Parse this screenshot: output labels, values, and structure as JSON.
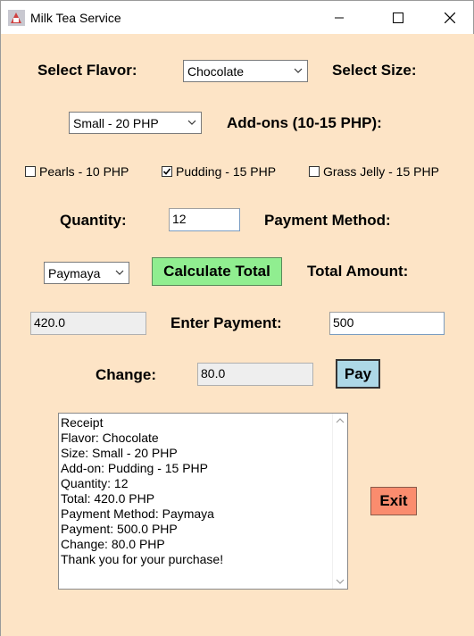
{
  "window": {
    "title": "Milk Tea Service",
    "controls": [
      "minimize",
      "maximize",
      "close"
    ]
  },
  "form": {
    "flavor_label": "Select Flavor:",
    "flavor_value": "Chocolate",
    "size_label": "Select Size:",
    "size_value": "Small - 20 PHP",
    "addons_label": "Add-ons (10-15 PHP):",
    "addons": [
      {
        "label": "Pearls - 10 PHP",
        "checked": false
      },
      {
        "label": "Pudding - 15 PHP",
        "checked": true
      },
      {
        "label": "Grass Jelly - 15 PHP",
        "checked": false
      }
    ],
    "quantity_label": "Quantity:",
    "quantity_value": "12",
    "payment_method_label": "Payment Method:",
    "payment_method_value": "Paymaya",
    "calculate_button": "Calculate Total",
    "total_label": "Total Amount:",
    "total_value": "420.0",
    "enter_payment_label": "Enter Payment:",
    "payment_value": "500",
    "change_label": "Change:",
    "change_value": "80.0",
    "pay_button": "Pay",
    "exit_button": "Exit"
  },
  "receipt": {
    "lines": [
      "Receipt",
      "Flavor: Chocolate",
      "Size: Small - 20 PHP",
      "Add-on: Pudding - 15 PHP",
      "Quantity: 12",
      "Total: 420.0 PHP",
      "Payment Method: Paymaya",
      "Payment: 500.0 PHP",
      "Change: 80.0 PHP",
      "Thank you for your purchase!"
    ]
  },
  "colors": {
    "background": "#fde4c6",
    "calculate_button": "#90ee90",
    "pay_button": "#add8e6",
    "exit_button": "#fa8c6e"
  }
}
